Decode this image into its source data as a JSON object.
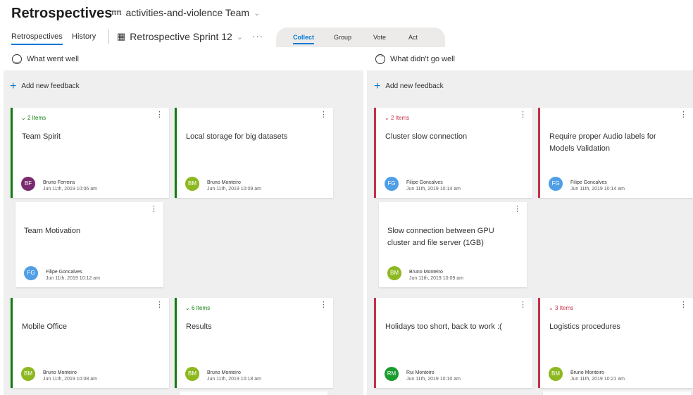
{
  "header": {
    "title": "Retrospectives",
    "team_name": "activities-and-violence Team",
    "team_icon": "people-icon",
    "nav": {
      "retrospectives": "Retrospectives",
      "history": "History"
    },
    "board_name": "Retrospective Sprint 12",
    "more": "···"
  },
  "phases": {
    "collect": "Collect",
    "group": "Group",
    "vote": "Vote",
    "act": "Act"
  },
  "colors": {
    "accent": "#0078d4",
    "good": "#107c10",
    "bad": "#c4314b"
  },
  "columns": {
    "went_well": {
      "title": "What went well",
      "icon": "smile-icon",
      "add_label": "Add new feedback",
      "cards": [
        {
          "group_count": "2 Items",
          "text": "Team Spirit",
          "initials": "BF",
          "author": "Bruno Ferreira",
          "date": "Jun 11th, 2019 10:06 am",
          "avatar_color": "#7a2a6e"
        },
        {
          "text": "Local storage for big datasets",
          "initials": "BM",
          "author": "Bruno Monteiro",
          "date": "Jun 11th, 2019 10:09 am",
          "avatar_color": "#8cb820"
        },
        {
          "text": "Team Motivation",
          "initials": "FG",
          "author": "Filipe Goncalves",
          "date": "Jun 11th, 2019 10:12 am",
          "avatar_color": "#4f9fe6"
        },
        {
          "text": "Mobile Office",
          "initials": "BM",
          "author": "Bruno Monteiro",
          "date": "Jun 11th, 2019 10:08 am",
          "avatar_color": "#8cb820"
        },
        {
          "group_count": "6 Items",
          "text": "Results",
          "initials": "BM",
          "author": "Bruno Monteiro",
          "date": "Jun 11th, 2019 10:18 am",
          "avatar_color": "#8cb820"
        }
      ]
    },
    "didnt_go_well": {
      "title": "What didn't go well",
      "icon": "frown-icon",
      "add_label": "Add new feedback",
      "cards": [
        {
          "group_count": "2 Items",
          "text": "Cluster slow connection",
          "initials": "FG",
          "author": "Filipe Goncalves",
          "date": "Jun 11th, 2019 10:14 am",
          "avatar_color": "#4f9fe6"
        },
        {
          "text": "Require proper Audio labels for Models Validation",
          "initials": "FG",
          "author": "Filipe Goncalves",
          "date": "Jun 11th, 2019 10:14 am",
          "avatar_color": "#4f9fe6"
        },
        {
          "text": "Slow connection between GPU cluster and file server (1GB)",
          "initials": "BM",
          "author": "Bruno Monteiro",
          "date": "Jun 11th, 2019 10:09 am",
          "avatar_color": "#8cb820"
        },
        {
          "text": "Holidays too short, back to work :(",
          "initials": "RM",
          "author": "Rui Monteiro",
          "date": "Jun 11th, 2019 10:10 am",
          "avatar_color": "#1a9c2f"
        },
        {
          "group_count": "3 Items",
          "text": "Logistics procedures",
          "initials": "BM",
          "author": "Bruno Monteiro",
          "date": "Jun 11th, 2019 10:21 am",
          "avatar_color": "#8cb820"
        }
      ]
    }
  }
}
